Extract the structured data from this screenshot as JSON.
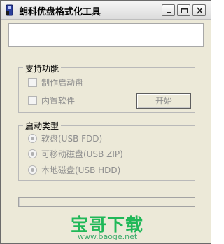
{
  "window": {
    "title": "朗科优盘格式化工具",
    "display_text": ""
  },
  "functions_group": {
    "legend": "支持功能",
    "options": [
      {
        "label": "制作启动盘",
        "checked": false,
        "enabled": false
      },
      {
        "label": "内置软件",
        "checked": false,
        "enabled": false
      }
    ],
    "start_button": "开始"
  },
  "boot_type_group": {
    "legend": "启动类型",
    "options": [
      {
        "label": "软盘(USB FDD)",
        "selected": false,
        "enabled": false
      },
      {
        "label": "可移动磁盘(USB ZIP)",
        "selected": false,
        "enabled": false
      },
      {
        "label": "本地磁盘(USB HDD)",
        "selected": false,
        "enabled": false
      }
    ]
  },
  "progress": {
    "value": 0
  },
  "watermark": {
    "brand": "宝哥下载",
    "url": "www.baoge.net"
  },
  "colors": {
    "window_bg": "#ece9d8",
    "disabled_text": "#8f8f8f",
    "watermark": "#20b858"
  },
  "icons": [
    "usb-drive-icon",
    "minimize-icon",
    "maximize-icon",
    "close-icon"
  ]
}
